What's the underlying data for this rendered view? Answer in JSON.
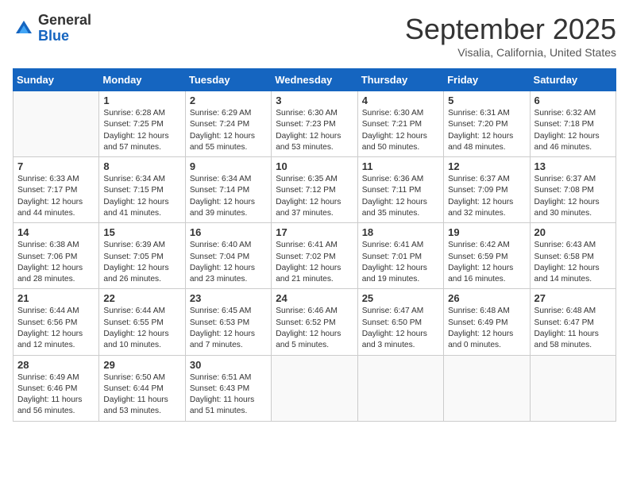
{
  "header": {
    "logo": {
      "general": "General",
      "blue": "Blue"
    },
    "title": "September 2025",
    "subtitle": "Visalia, California, United States"
  },
  "weekdays": [
    "Sunday",
    "Monday",
    "Tuesday",
    "Wednesday",
    "Thursday",
    "Friday",
    "Saturday"
  ],
  "weeks": [
    [
      {
        "day": "",
        "info": ""
      },
      {
        "day": "1",
        "info": "Sunrise: 6:28 AM\nSunset: 7:25 PM\nDaylight: 12 hours\nand 57 minutes."
      },
      {
        "day": "2",
        "info": "Sunrise: 6:29 AM\nSunset: 7:24 PM\nDaylight: 12 hours\nand 55 minutes."
      },
      {
        "day": "3",
        "info": "Sunrise: 6:30 AM\nSunset: 7:23 PM\nDaylight: 12 hours\nand 53 minutes."
      },
      {
        "day": "4",
        "info": "Sunrise: 6:30 AM\nSunset: 7:21 PM\nDaylight: 12 hours\nand 50 minutes."
      },
      {
        "day": "5",
        "info": "Sunrise: 6:31 AM\nSunset: 7:20 PM\nDaylight: 12 hours\nand 48 minutes."
      },
      {
        "day": "6",
        "info": "Sunrise: 6:32 AM\nSunset: 7:18 PM\nDaylight: 12 hours\nand 46 minutes."
      }
    ],
    [
      {
        "day": "7",
        "info": "Sunrise: 6:33 AM\nSunset: 7:17 PM\nDaylight: 12 hours\nand 44 minutes."
      },
      {
        "day": "8",
        "info": "Sunrise: 6:34 AM\nSunset: 7:15 PM\nDaylight: 12 hours\nand 41 minutes."
      },
      {
        "day": "9",
        "info": "Sunrise: 6:34 AM\nSunset: 7:14 PM\nDaylight: 12 hours\nand 39 minutes."
      },
      {
        "day": "10",
        "info": "Sunrise: 6:35 AM\nSunset: 7:12 PM\nDaylight: 12 hours\nand 37 minutes."
      },
      {
        "day": "11",
        "info": "Sunrise: 6:36 AM\nSunset: 7:11 PM\nDaylight: 12 hours\nand 35 minutes."
      },
      {
        "day": "12",
        "info": "Sunrise: 6:37 AM\nSunset: 7:09 PM\nDaylight: 12 hours\nand 32 minutes."
      },
      {
        "day": "13",
        "info": "Sunrise: 6:37 AM\nSunset: 7:08 PM\nDaylight: 12 hours\nand 30 minutes."
      }
    ],
    [
      {
        "day": "14",
        "info": "Sunrise: 6:38 AM\nSunset: 7:06 PM\nDaylight: 12 hours\nand 28 minutes."
      },
      {
        "day": "15",
        "info": "Sunrise: 6:39 AM\nSunset: 7:05 PM\nDaylight: 12 hours\nand 26 minutes."
      },
      {
        "day": "16",
        "info": "Sunrise: 6:40 AM\nSunset: 7:04 PM\nDaylight: 12 hours\nand 23 minutes."
      },
      {
        "day": "17",
        "info": "Sunrise: 6:41 AM\nSunset: 7:02 PM\nDaylight: 12 hours\nand 21 minutes."
      },
      {
        "day": "18",
        "info": "Sunrise: 6:41 AM\nSunset: 7:01 PM\nDaylight: 12 hours\nand 19 minutes."
      },
      {
        "day": "19",
        "info": "Sunrise: 6:42 AM\nSunset: 6:59 PM\nDaylight: 12 hours\nand 16 minutes."
      },
      {
        "day": "20",
        "info": "Sunrise: 6:43 AM\nSunset: 6:58 PM\nDaylight: 12 hours\nand 14 minutes."
      }
    ],
    [
      {
        "day": "21",
        "info": "Sunrise: 6:44 AM\nSunset: 6:56 PM\nDaylight: 12 hours\nand 12 minutes."
      },
      {
        "day": "22",
        "info": "Sunrise: 6:44 AM\nSunset: 6:55 PM\nDaylight: 12 hours\nand 10 minutes."
      },
      {
        "day": "23",
        "info": "Sunrise: 6:45 AM\nSunset: 6:53 PM\nDaylight: 12 hours\nand 7 minutes."
      },
      {
        "day": "24",
        "info": "Sunrise: 6:46 AM\nSunset: 6:52 PM\nDaylight: 12 hours\nand 5 minutes."
      },
      {
        "day": "25",
        "info": "Sunrise: 6:47 AM\nSunset: 6:50 PM\nDaylight: 12 hours\nand 3 minutes."
      },
      {
        "day": "26",
        "info": "Sunrise: 6:48 AM\nSunset: 6:49 PM\nDaylight: 12 hours\nand 0 minutes."
      },
      {
        "day": "27",
        "info": "Sunrise: 6:48 AM\nSunset: 6:47 PM\nDaylight: 11 hours\nand 58 minutes."
      }
    ],
    [
      {
        "day": "28",
        "info": "Sunrise: 6:49 AM\nSunset: 6:46 PM\nDaylight: 11 hours\nand 56 minutes."
      },
      {
        "day": "29",
        "info": "Sunrise: 6:50 AM\nSunset: 6:44 PM\nDaylight: 11 hours\nand 53 minutes."
      },
      {
        "day": "30",
        "info": "Sunrise: 6:51 AM\nSunset: 6:43 PM\nDaylight: 11 hours\nand 51 minutes."
      },
      {
        "day": "",
        "info": ""
      },
      {
        "day": "",
        "info": ""
      },
      {
        "day": "",
        "info": ""
      },
      {
        "day": "",
        "info": ""
      }
    ]
  ]
}
